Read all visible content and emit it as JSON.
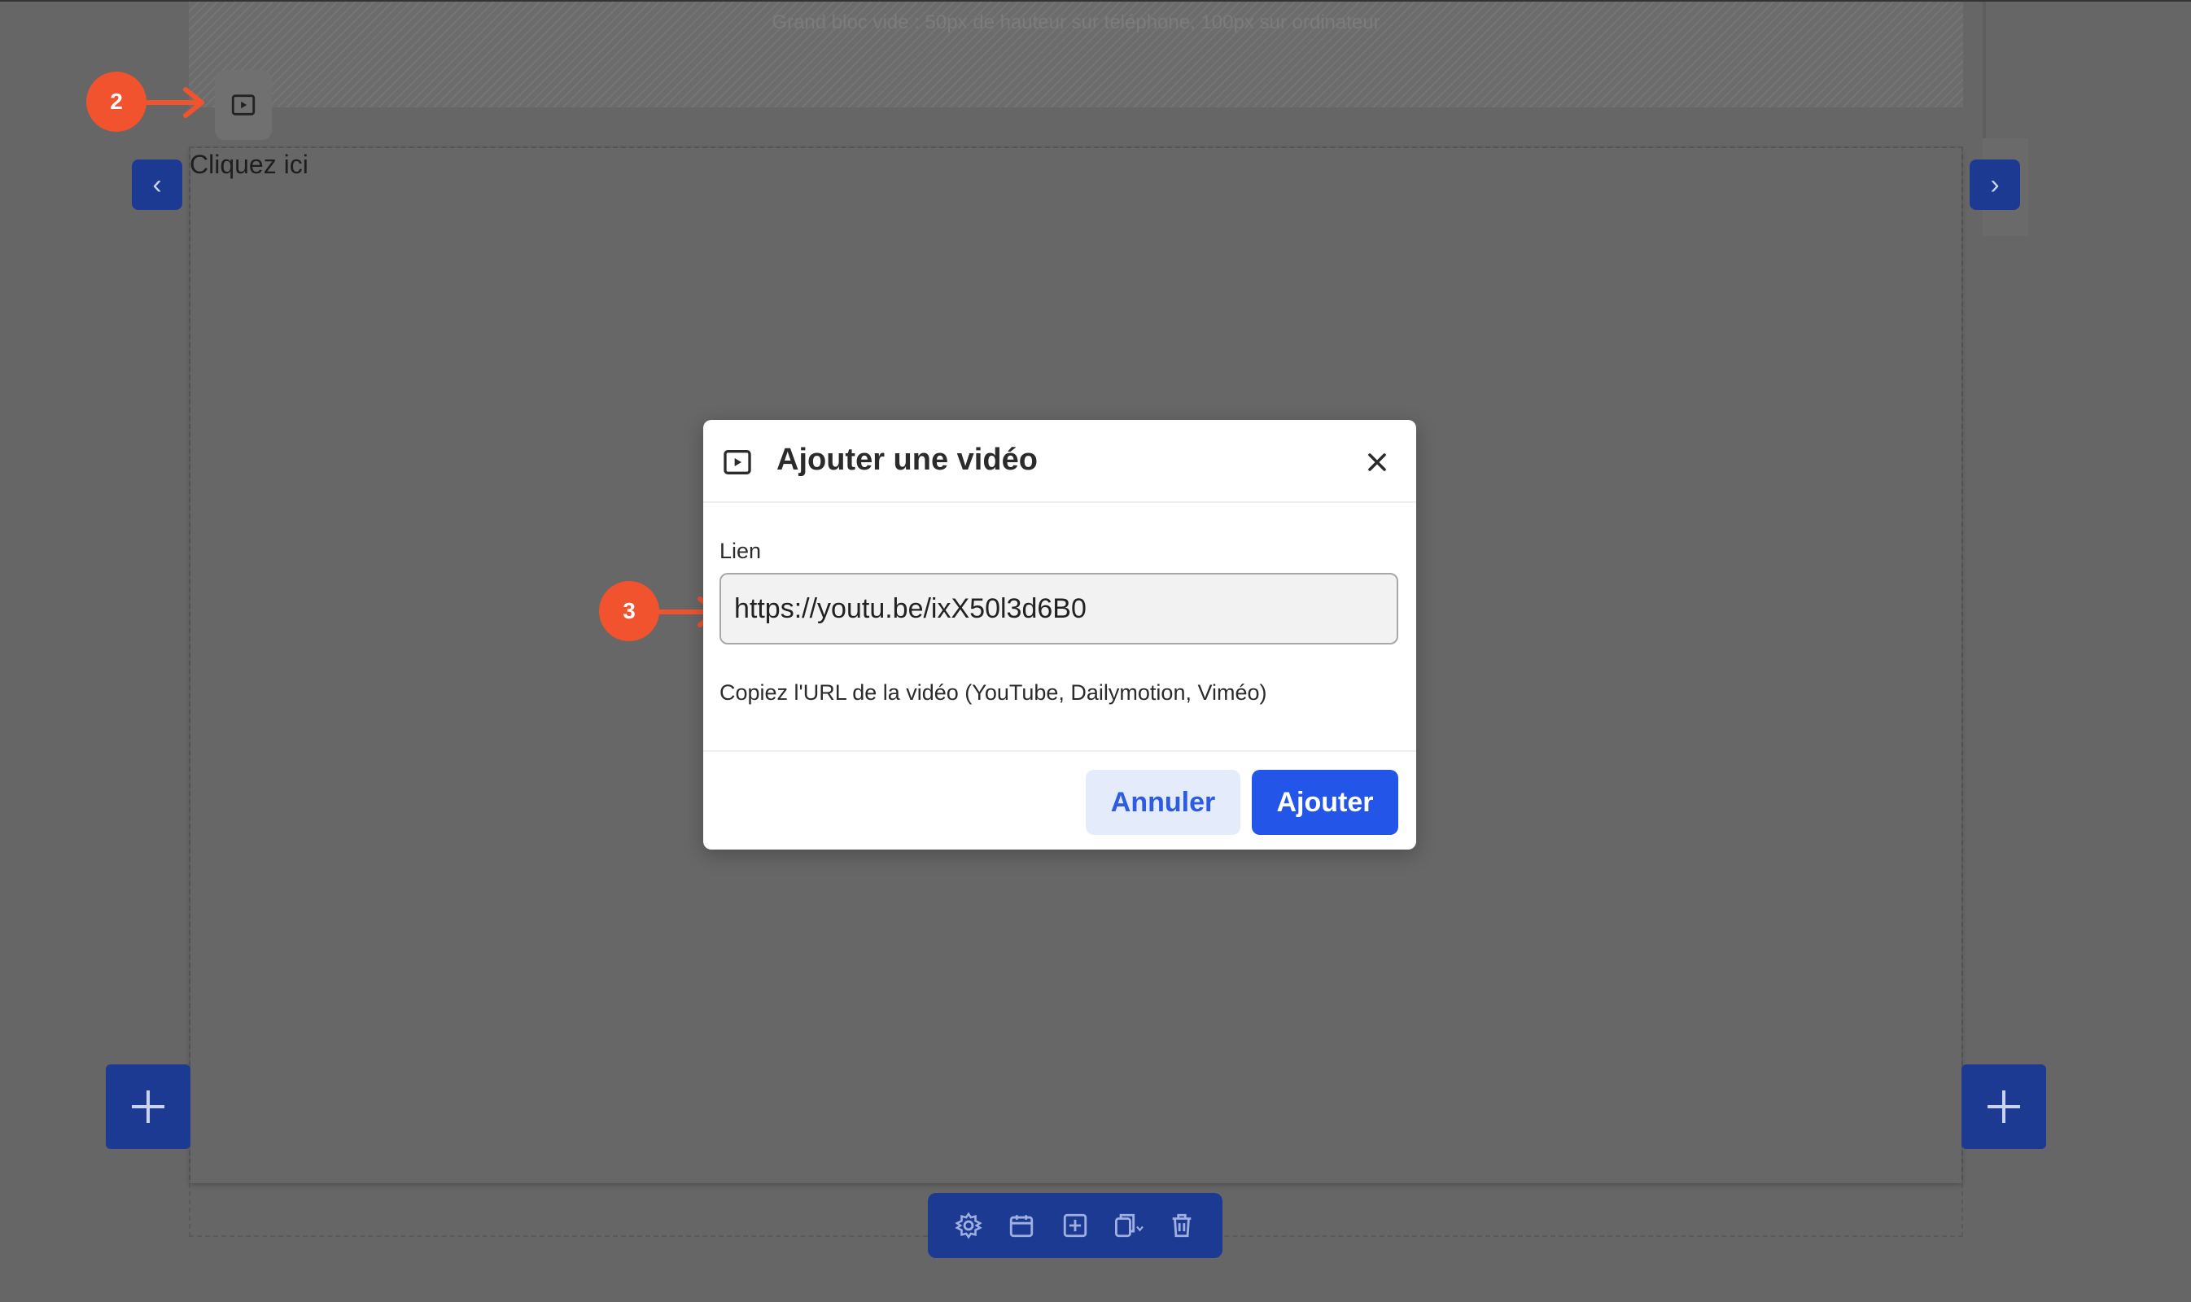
{
  "canvas": {
    "spacer_text": "Grand bloc vide : 50px de hauteur sur téléphone, 100px sur ordinateur",
    "placeholder_text": "Cliquez ici"
  },
  "markers": {
    "step_2": "2",
    "step_3": "3"
  },
  "toolbar": {
    "icons": [
      "gear-icon",
      "calendar-icon",
      "add-square-icon",
      "duplicate-icon",
      "trash-icon"
    ]
  },
  "modal": {
    "title": "Ajouter une vidéo",
    "icon": "video-play-icon",
    "field_label": "Lien",
    "url_value": "https://youtu.be/ixX50l3d6B0",
    "help_text": "Copiez l'URL de la vidéo (YouTube, Dailymotion, Viméo)",
    "cancel_label": "Annuler",
    "submit_label": "Ajouter"
  },
  "colors": {
    "overlay_bg": "#666666",
    "accent_blue": "#2355e8",
    "dark_blue": "#1d3a92",
    "marker_orange": "#f0532d",
    "cancel_bg": "#e4ecfc"
  }
}
